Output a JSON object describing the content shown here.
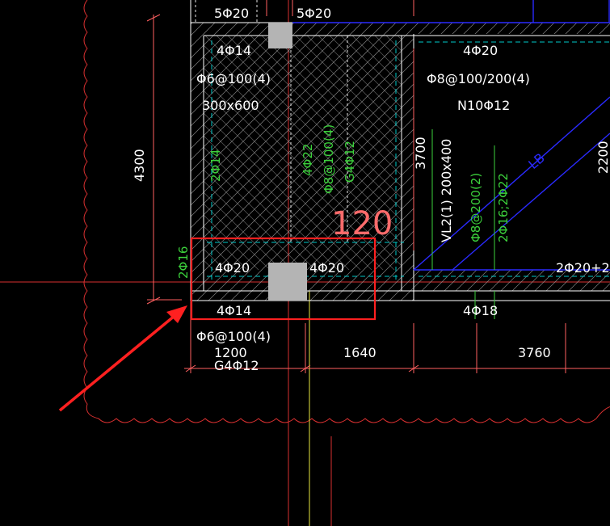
{
  "colors": {
    "background": "#000000",
    "red_line": "#ff3030",
    "green_text": "#3cd23c",
    "white_text": "#ffffff",
    "blue_line": "#2a2aff",
    "cyan_line": "#00c8c8",
    "grey_block": "#b4b4b4",
    "highlight_box": "#ff2020"
  },
  "labels": {
    "top_left_bar": "5Φ20",
    "top_right_bar": "5Φ20",
    "upper_left_bar": "4Φ14",
    "stirrup_left": "Φ6@100(4)",
    "beam_size": "300x600",
    "upper_right_bar": "4Φ20",
    "stirrup_right": "Φ8@100/200(4)",
    "torsion_bar": "N10Φ12",
    "dim_4300": "4300",
    "side_2phi14": "2Φ14",
    "side_4phi22": "4Φ22",
    "side_stirrup": "Φ8@100(4)",
    "side_g4phi12": "G4Φ12",
    "dim_3700": "3700",
    "vl2": "VL2(1) 200x400",
    "vl2_stirrup": "Φ8@200(2)",
    "vl2_bars": "2Φ16;2Φ22",
    "slab_120": "120",
    "lb_label": "LB",
    "dim_2200": "2200",
    "left_2phi16": "2Φ16",
    "box_left_bar": "4Φ20",
    "box_right_bar": "4Φ20",
    "right_bars": "2Φ20+2",
    "bottom_4phi14": "4Φ14",
    "bottom_4phi18": "4Φ18",
    "bottom_stirrup": "Φ6@100(4)",
    "dim_1200": "1200",
    "bottom_g4phi12": "G4Φ12",
    "dim_1640": "1640",
    "dim_3760": "3760"
  }
}
